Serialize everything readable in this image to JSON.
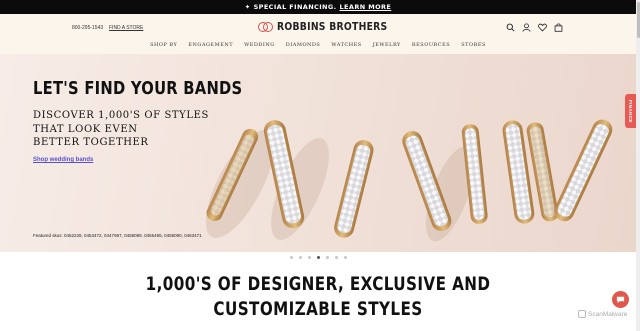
{
  "promo": {
    "text": "SPECIAL FINANCING.",
    "link": "LEARN MORE"
  },
  "header": {
    "phone": "800-295-1543",
    "find_store": "FIND A STORE",
    "logo": "ROBBINS BROTHERS",
    "icons": [
      "search-icon",
      "account-icon",
      "heart-icon",
      "bag-icon"
    ]
  },
  "nav": [
    "SHOP BY",
    "ENGAGEMENT",
    "WEDDING",
    "DIAMONDS",
    "WATCHES",
    "JEWELRY",
    "RESOURCES",
    "STORES"
  ],
  "hero": {
    "title": "LET'S FIND YOUR BANDS",
    "subtitle": [
      "DISCOVER 1,000'S OF STYLES",
      "THAT LOOK EVEN",
      "BETTER TOGETHER"
    ],
    "cta": "Shop wedding bands",
    "skus": "Featured skus: 0452228, 0453472, 0447967, 0458089, 0455495, 0458090, 0463471"
  },
  "carousel": {
    "count": 7,
    "active": 3
  },
  "finance_tab": "FINANCE",
  "section": {
    "title_line1": "1,000'S OF DESIGNER, EXCLUSIVE AND",
    "title_line2": "CUSTOMIZABLE STYLES"
  },
  "watermark": "ScanMalware",
  "colors": {
    "promo_bg": "#0b0b0b",
    "header_bg": "#fbf5ec",
    "accent": "#e85a54",
    "link": "#5a4fd1"
  }
}
